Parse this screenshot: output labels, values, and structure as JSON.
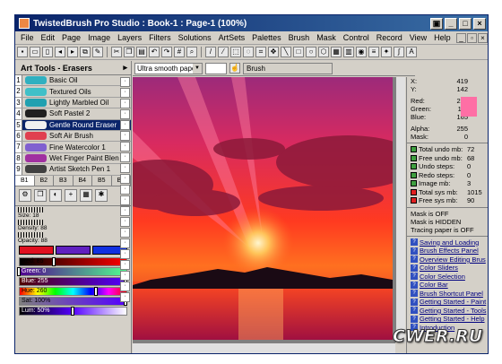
{
  "window": {
    "title": "TwistedBrush Pro Studio : Book-1 : Page-1 (100%)"
  },
  "menu": [
    "File",
    "Edit",
    "Page",
    "Image",
    "Layers",
    "Filters",
    "Solutions",
    "ArtSets",
    "Palettes",
    "Brush",
    "Mask",
    "Control",
    "Record",
    "View",
    "Help"
  ],
  "tools_panel": {
    "title": "Art Tools - Erasers",
    "brushes": [
      {
        "num": "1",
        "label": "Basic Oil",
        "color": "#30b0c0"
      },
      {
        "num": "2",
        "label": "Textured Oils",
        "color": "#40c0c8"
      },
      {
        "num": "3",
        "label": "Lightly Marbled Oil",
        "color": "#20a0b0"
      },
      {
        "num": "4",
        "label": "Soft Pastel 2",
        "color": "#202020"
      },
      {
        "num": "5",
        "label": "Gentle Round Eraser",
        "color": "#f0f0f0"
      },
      {
        "num": "6",
        "label": "Soft Air Brush",
        "color": "#e04050"
      },
      {
        "num": "7",
        "label": "Fine Watercolor 1",
        "color": "#8060d0"
      },
      {
        "num": "8",
        "label": "Wet Finger Paint Blen",
        "color": "#a030a0"
      },
      {
        "num": "9",
        "label": "Artist Sketch Pen 1",
        "color": "#404040"
      }
    ],
    "tabs": [
      "B1",
      "B2",
      "B3",
      "B4",
      "B5",
      "B6"
    ],
    "sliders": [
      {
        "label": "Size: 18"
      },
      {
        "label": "Density: 88"
      },
      {
        "label": "Opacity: 88"
      }
    ],
    "color_bars": [
      {
        "label": "Red: 85",
        "fill": 0.33
      },
      {
        "label": "Green: 0",
        "fill": 0.0
      },
      {
        "label": "Blue: 255",
        "fill": 1.0
      },
      {
        "label": "Hue: 260",
        "fill": 0.72
      },
      {
        "label": "Sat: 100%",
        "fill": 1.0
      },
      {
        "label": "Lum: 50%",
        "fill": 0.5
      }
    ]
  },
  "options_bar": {
    "paper": "Ultra smooth paper",
    "brush_label": "Brush"
  },
  "info": {
    "x": "419",
    "y": "142",
    "red": "254",
    "green": "111",
    "blue": "165",
    "alpha": "255",
    "mask": "0",
    "swatch_color": "#fe6fa5"
  },
  "memory": [
    {
      "label": "Total undo mb:",
      "value": "72"
    },
    {
      "label": "Free undo mb:",
      "value": "68"
    },
    {
      "label": "Undo steps:",
      "value": "0"
    },
    {
      "label": "Redo steps:",
      "value": "0"
    },
    {
      "label": "Image mb:",
      "value": "3"
    },
    {
      "label": "Total sys mb:",
      "value": "1015"
    },
    {
      "label": "Free sys mb:",
      "value": "90"
    }
  ],
  "status_lines": [
    "Mask is OFF",
    "Mask is HIDDEN",
    "Tracing paper is OFF"
  ],
  "help_links": [
    "Saving and Loading",
    "Brush Effects Panel",
    "Overview Editing Brus",
    "Color Sliders",
    "Color Selection",
    "Color Bar",
    "Brush Shortcut Panel",
    "Getting Started - Paint",
    "Getting Started - Tools",
    "Getting Started - Help",
    "Introduction"
  ],
  "watermark": "CWER.RU"
}
